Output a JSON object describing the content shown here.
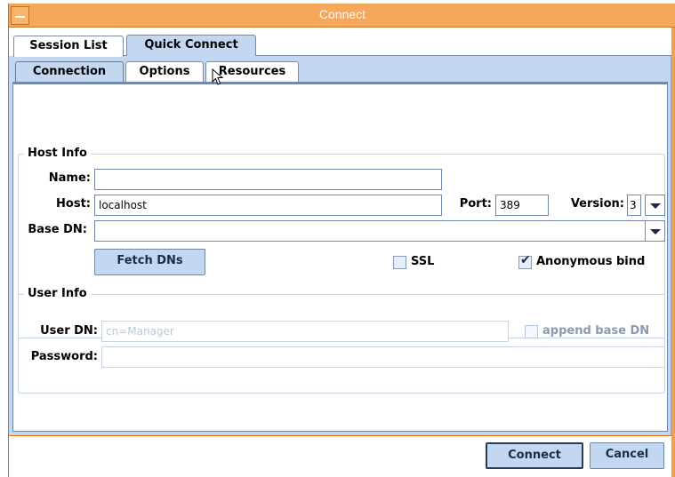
{
  "window": {
    "title": "Connect"
  },
  "outer_tabs": [
    {
      "label": "Session List"
    },
    {
      "label": "Quick Connect"
    }
  ],
  "inner_tabs": [
    {
      "label": "Connection"
    },
    {
      "label": "Options"
    },
    {
      "label": "Resources"
    }
  ],
  "host_info": {
    "title": "Host Info",
    "name_label": "Name:",
    "name_value": "",
    "host_label": "Host:",
    "host_value": "localhost",
    "port_label": "Port:",
    "port_value": "389",
    "version_label": "Version:",
    "version_value": "3",
    "base_dn_label": "Base DN:",
    "base_dn_value": "",
    "fetch_button": "Fetch DNs",
    "ssl_label": "SSL",
    "ssl_checked": false,
    "anon_label": "Anonymous bind",
    "anon_checked": true
  },
  "user_info": {
    "title": "User Info",
    "user_dn_label": "User DN:",
    "user_dn_placeholder": "cn=Manager",
    "append_label": "append base DN",
    "password_label": "Password:"
  },
  "buttons": {
    "connect": "Connect",
    "cancel": "Cancel"
  },
  "colors": {
    "frame": "#f0a14a",
    "tab_selected": "#c4d7f0",
    "border": "#6f86ac"
  }
}
